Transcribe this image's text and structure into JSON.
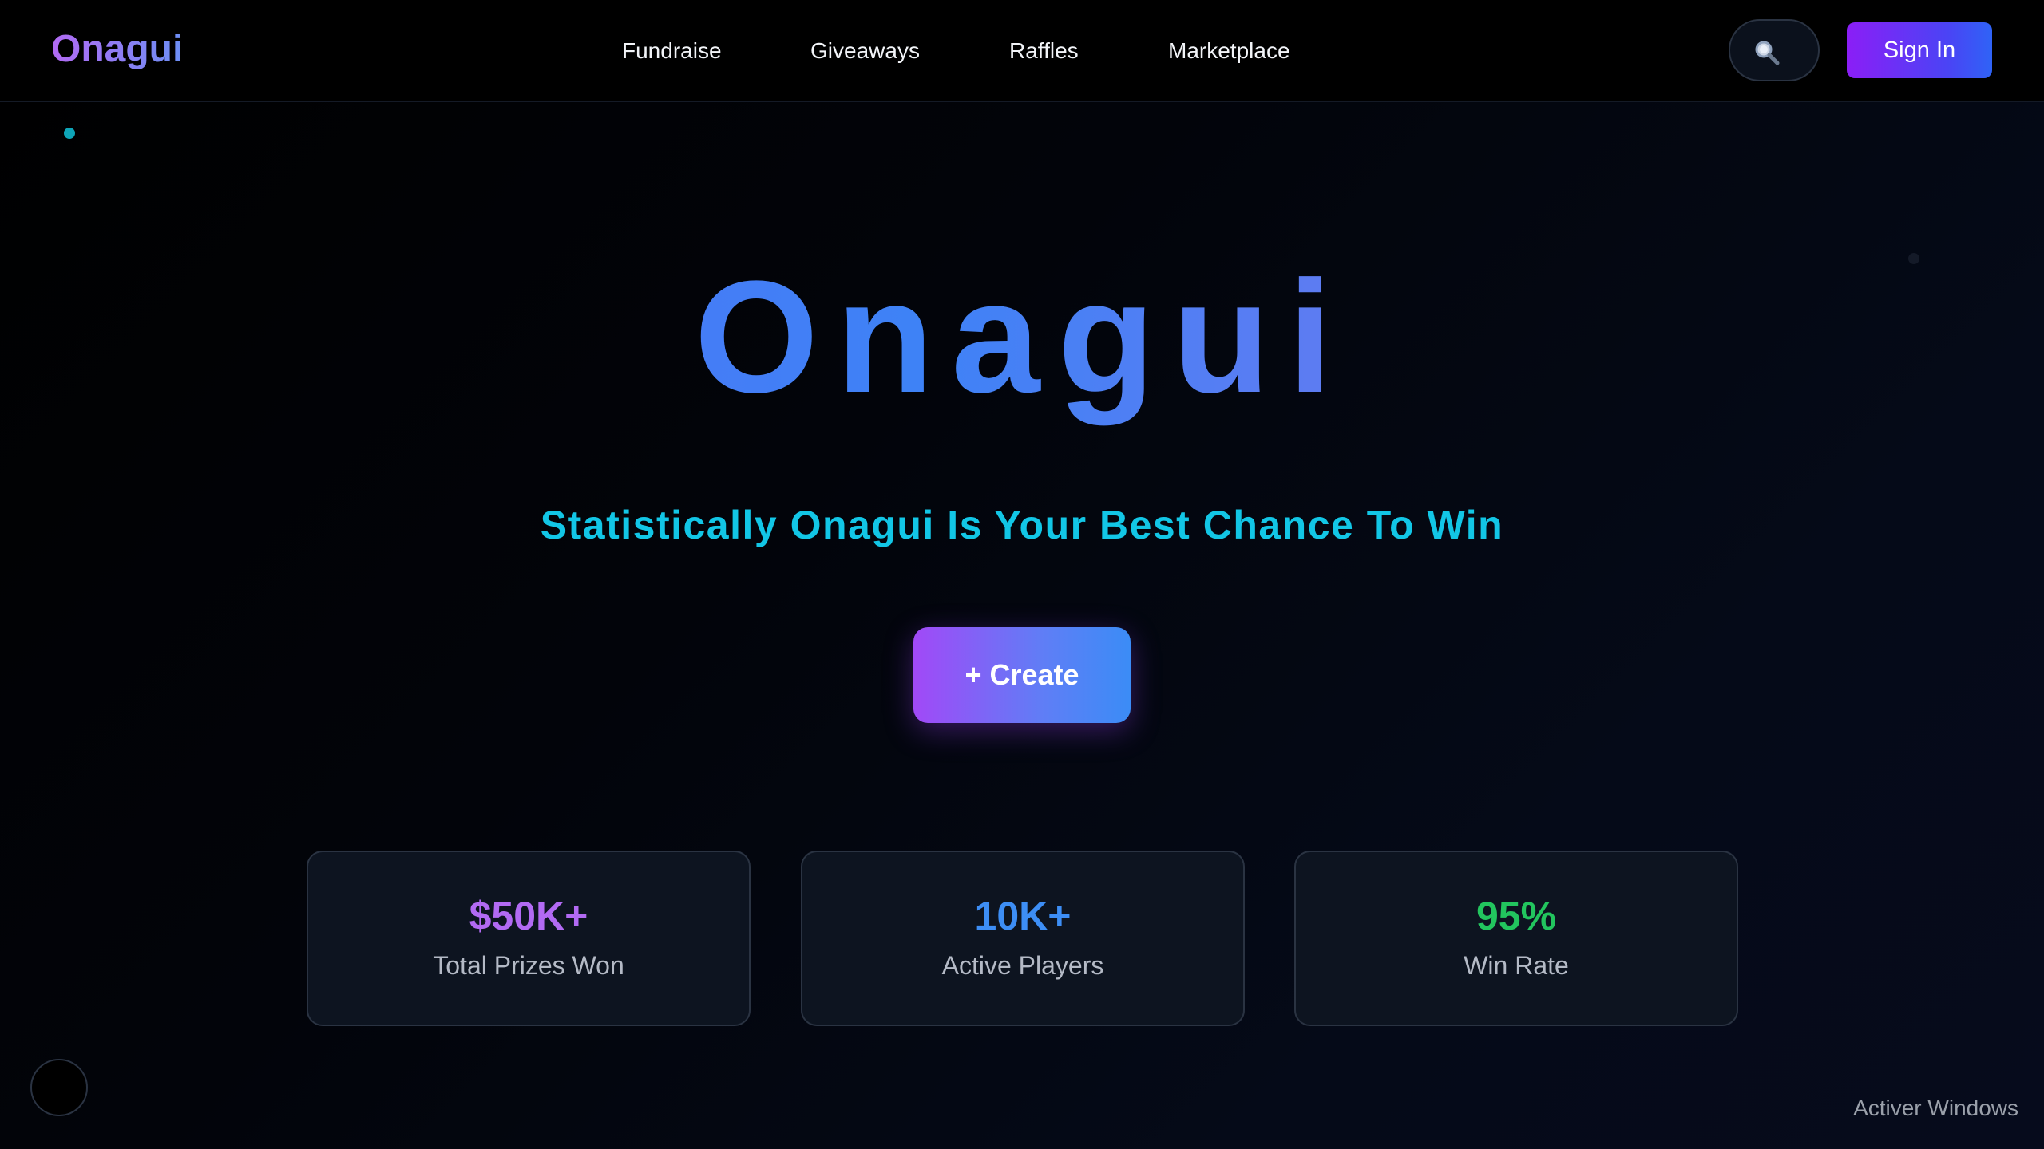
{
  "navbar": {
    "logo": "Onagui",
    "links": [
      "Fundraise",
      "Giveaways",
      "Raffles",
      "Marketplace"
    ],
    "search_icon": "search-icon",
    "signin_label": "Sign In"
  },
  "hero": {
    "title": "Onagui",
    "tagline": "Statistically Onagui Is Your Best Chance To Win",
    "create_label": "+ Create"
  },
  "stats": [
    {
      "value": "$50K+",
      "label": "Total Prizes Won",
      "color": "#b26af3"
    },
    {
      "value": "10K+",
      "label": "Active Players",
      "color": "#3d8ef5"
    },
    {
      "value": "95%",
      "label": "Win Rate",
      "color": "#22c55e"
    }
  ],
  "os_watermark": "Activer Windows",
  "colors": {
    "accent_purple": "#8b1ef6",
    "accent_blue": "#3e82f6",
    "tagline_cyan": "#12c6e6",
    "background": "#000000"
  }
}
